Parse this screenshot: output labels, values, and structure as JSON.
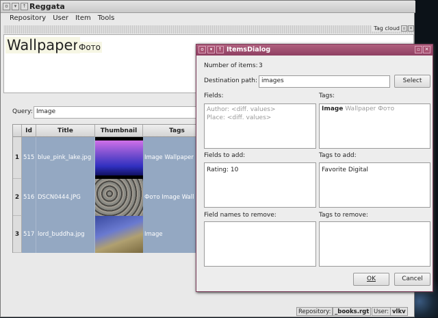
{
  "main_window": {
    "title": "Reggata",
    "menu": [
      "Repository",
      "User",
      "Item",
      "Tools"
    ]
  },
  "tag_cloud": {
    "title": "Tag cloud",
    "tags": [
      "Wallpaper",
      "Фото"
    ]
  },
  "query": {
    "label": "Query:",
    "value": "Image"
  },
  "table": {
    "columns": [
      "Id",
      "Title",
      "Thumbnail",
      "Tags"
    ],
    "rows": [
      {
        "num": "1",
        "id": "515",
        "title": "blue_pink_lake.jpg",
        "tags": "Image Wallpaper"
      },
      {
        "num": "2",
        "id": "516",
        "title": "DSCN0444.JPG",
        "tags": "Фото Image Wall"
      },
      {
        "num": "3",
        "id": "517",
        "title": "lord_buddha.jpg",
        "tags": "Image"
      }
    ]
  },
  "status": {
    "repo_label": "Repository:",
    "repo": "_books.rgt",
    "user_label": "User:",
    "user": "vlkv"
  },
  "dialog": {
    "title": "ItemsDialog",
    "num_items_label": "Number of items:",
    "num_items": "3",
    "dest_label": "Destination path:",
    "dest_value": "images",
    "select": "Select",
    "fields_label": "Fields:",
    "fields": [
      "Author: <diff. values>",
      "Place: <diff. values>"
    ],
    "tags_label": "Tags:",
    "tags_common": "Image",
    "tags_other": "Wallpaper Фото",
    "fields_add_label": "Fields to add:",
    "fields_add": "Rating: 10",
    "tags_add_label": "Tags to add:",
    "tags_add": "Favorite Digital",
    "field_remove_label": "Field names to remove:",
    "tags_remove_label": "Tags to remove:",
    "ok": "OK",
    "cancel": "Cancel"
  }
}
